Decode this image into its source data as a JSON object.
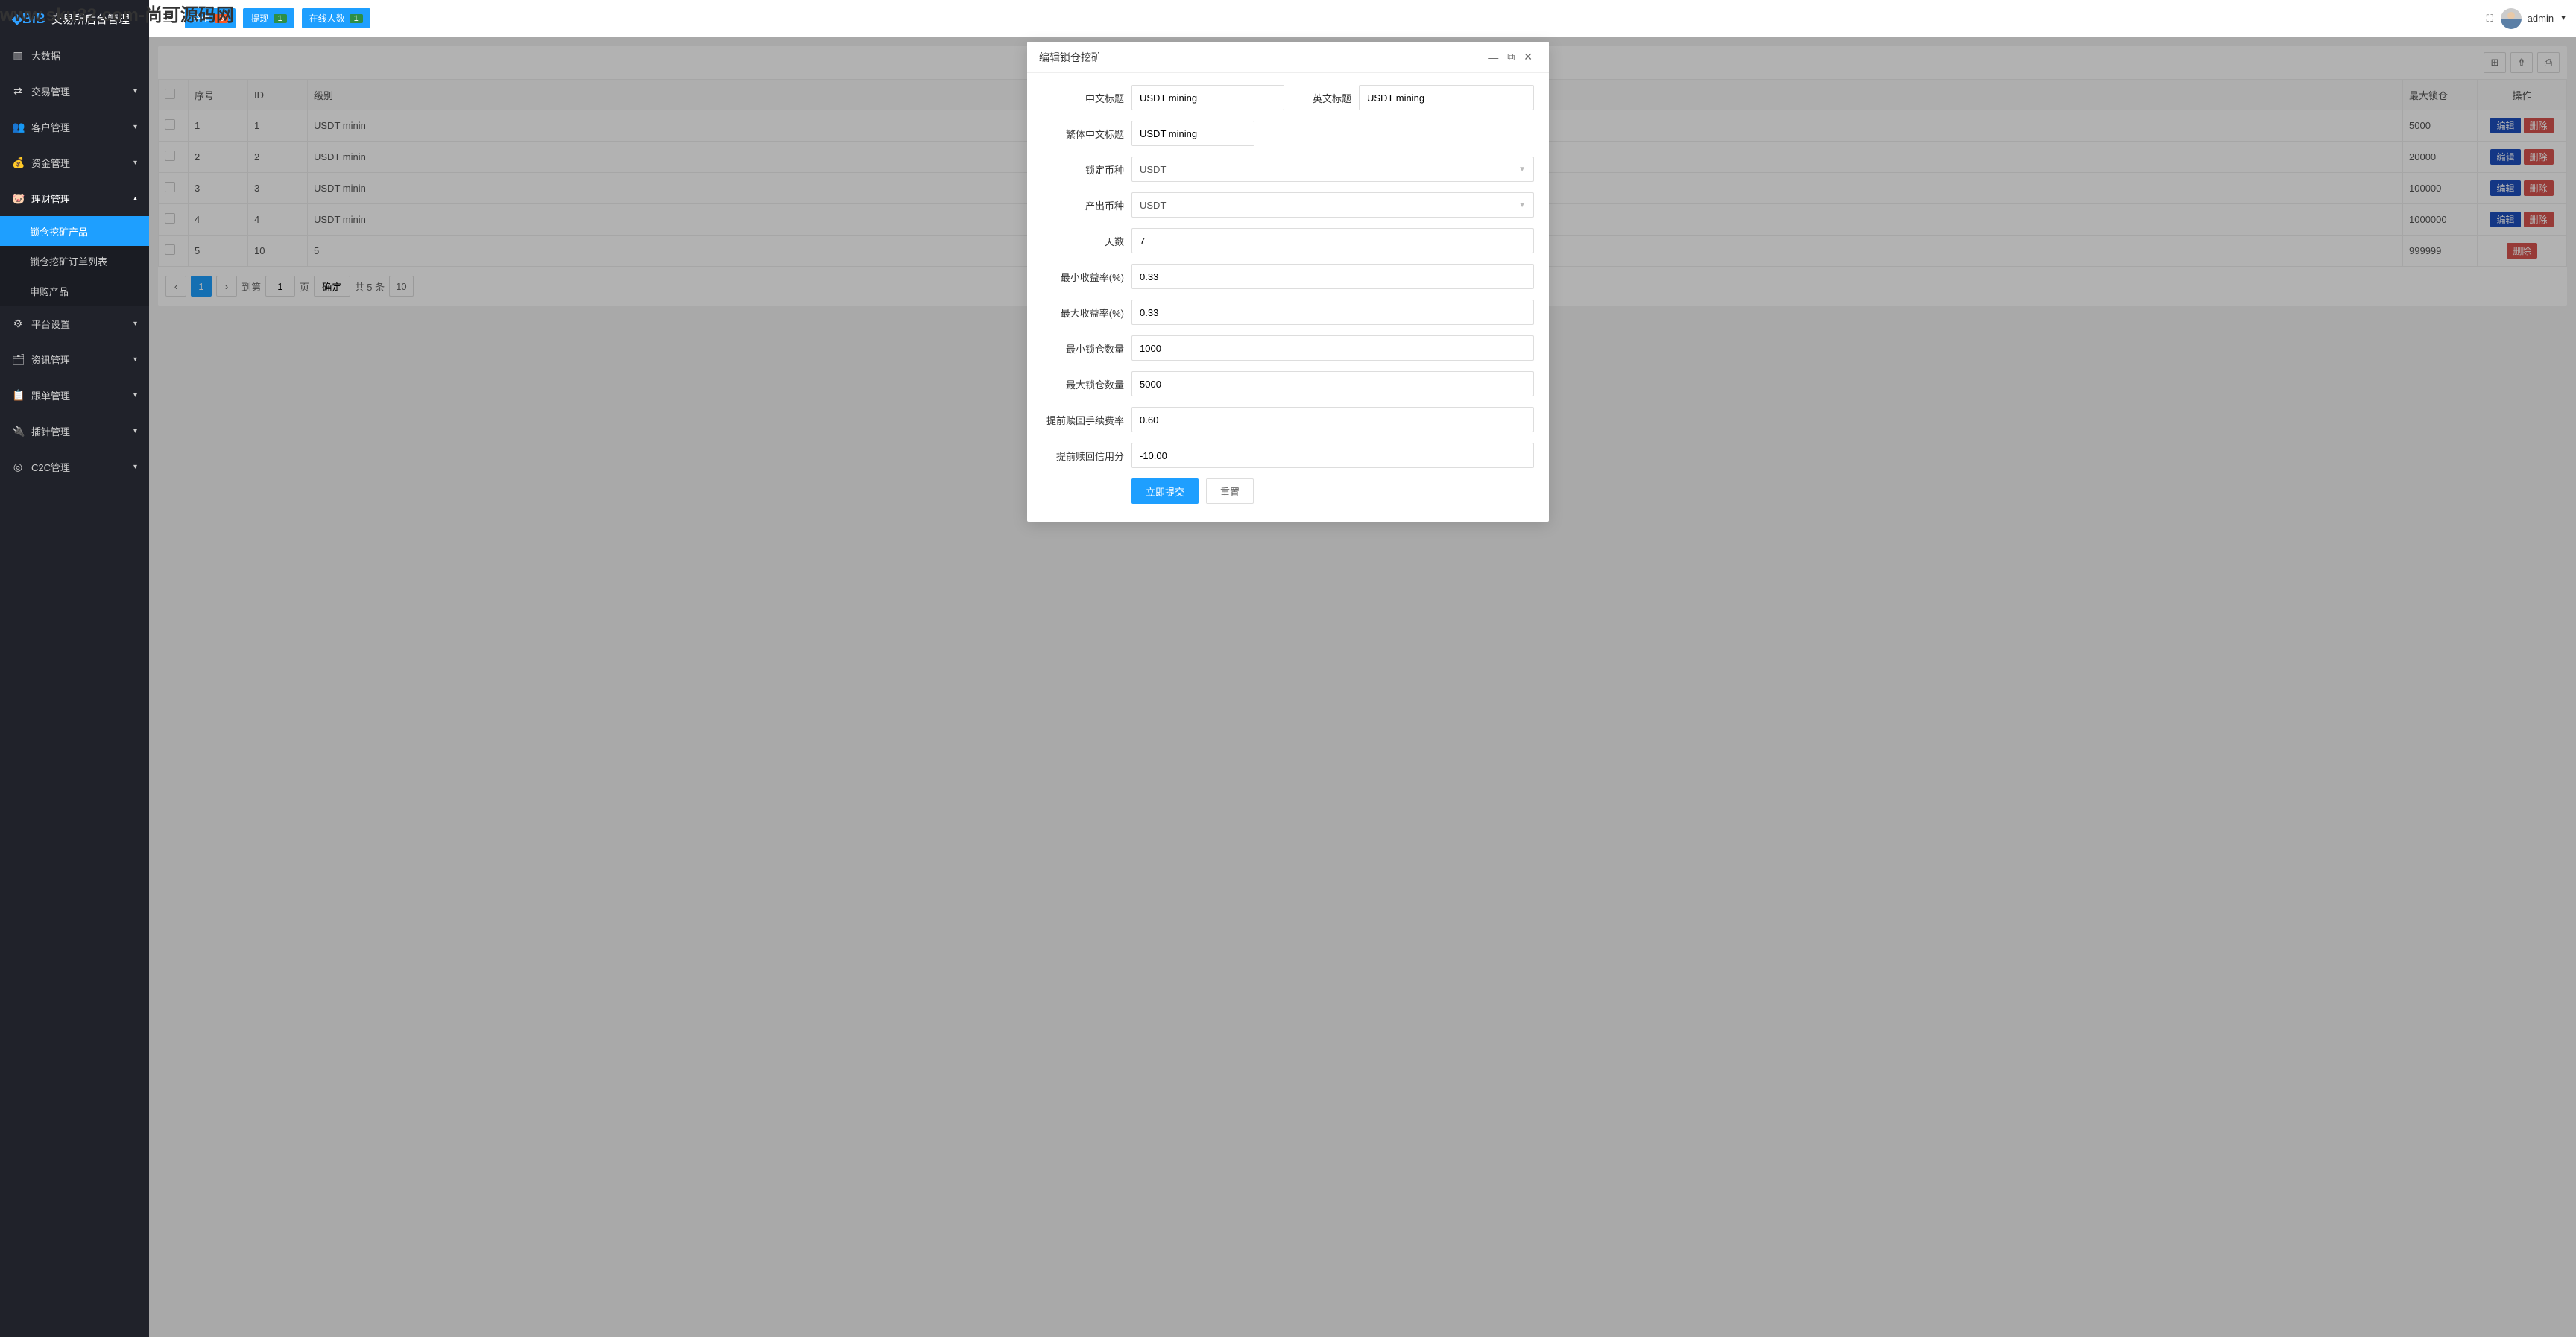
{
  "watermark": "www.sku32.com-尚可源码网",
  "logo": {
    "brand": "BiB",
    "title": "交易所后台管理"
  },
  "topbar": {
    "recharge": {
      "label": "充值",
      "count": "3"
    },
    "withdraw": {
      "label": "提现",
      "count": "1"
    },
    "online": {
      "label": "在线人数",
      "count": "1"
    },
    "user": "admin"
  },
  "sidebar": {
    "items": [
      {
        "icon": "▥",
        "label": "大数据"
      },
      {
        "icon": "⇄",
        "label": "交易管理",
        "expandable": true
      },
      {
        "icon": "👥",
        "label": "客户管理",
        "expandable": true
      },
      {
        "icon": "💰",
        "label": "资金管理",
        "expandable": true
      },
      {
        "icon": "🐷",
        "label": "理财管理",
        "expandable": true,
        "open": true,
        "children": [
          {
            "label": "锁仓挖矿产品",
            "active": true
          },
          {
            "label": "锁仓挖矿订单列表"
          },
          {
            "label": "申购产品"
          }
        ]
      },
      {
        "icon": "⚙",
        "label": "平台设置",
        "expandable": true
      },
      {
        "icon": "🗂",
        "label": "资讯管理",
        "expandable": true
      },
      {
        "icon": "📋",
        "label": "跟单管理",
        "expandable": true
      },
      {
        "icon": "🔌",
        "label": "插针管理",
        "expandable": true
      },
      {
        "icon": "◎",
        "label": "C2C管理",
        "expandable": true
      }
    ]
  },
  "table": {
    "headers": {
      "seq": "序号",
      "id": "ID",
      "level": "级别",
      "maxlock": "最大锁仓",
      "ops": "操作"
    },
    "edit": "编辑",
    "del": "删除",
    "rows": [
      {
        "seq": "1",
        "id": "1",
        "level": "USDT minin",
        "maxlock": "5000",
        "edit": true
      },
      {
        "seq": "2",
        "id": "2",
        "level": "USDT minin",
        "maxlock": "20000",
        "edit": true
      },
      {
        "seq": "3",
        "id": "3",
        "level": "USDT minin",
        "maxlock": "100000",
        "edit": true
      },
      {
        "seq": "4",
        "id": "4",
        "level": "USDT minin",
        "maxlock": "1000000",
        "edit": true
      },
      {
        "seq": "5",
        "id": "10",
        "level": "5",
        "maxlock": "999999",
        "edit": false
      }
    ]
  },
  "pager": {
    "page": "1",
    "goto_label": "到第",
    "page_unit": "页",
    "confirm": "确定",
    "total": "共 5 条",
    "size": "10"
  },
  "modal": {
    "title": "编辑锁仓挖矿",
    "labels": {
      "title_cn": "中文标题",
      "title_en": "英文标题",
      "title_tc": "繁体中文标题",
      "lock_coin": "锁定币种",
      "out_coin": "产出币种",
      "days": "天数",
      "min_yield": "最小收益率(%)",
      "max_yield": "最大收益率(%)",
      "min_lock": "最小锁仓数量",
      "max_lock": "最大锁仓数量",
      "early_fee": "提前赎回手续费率",
      "early_credit": "提前赎回信用分"
    },
    "values": {
      "title_cn": "USDT mining",
      "title_en": "USDT mining",
      "title_tc": "USDT mining",
      "lock_coin": "USDT",
      "out_coin": "USDT",
      "days": "7",
      "min_yield": "0.33",
      "max_yield": "0.33",
      "min_lock": "1000",
      "max_lock": "5000",
      "early_fee": "0.60",
      "early_credit": "-10.00"
    },
    "submit": "立即提交",
    "reset": "重置"
  }
}
